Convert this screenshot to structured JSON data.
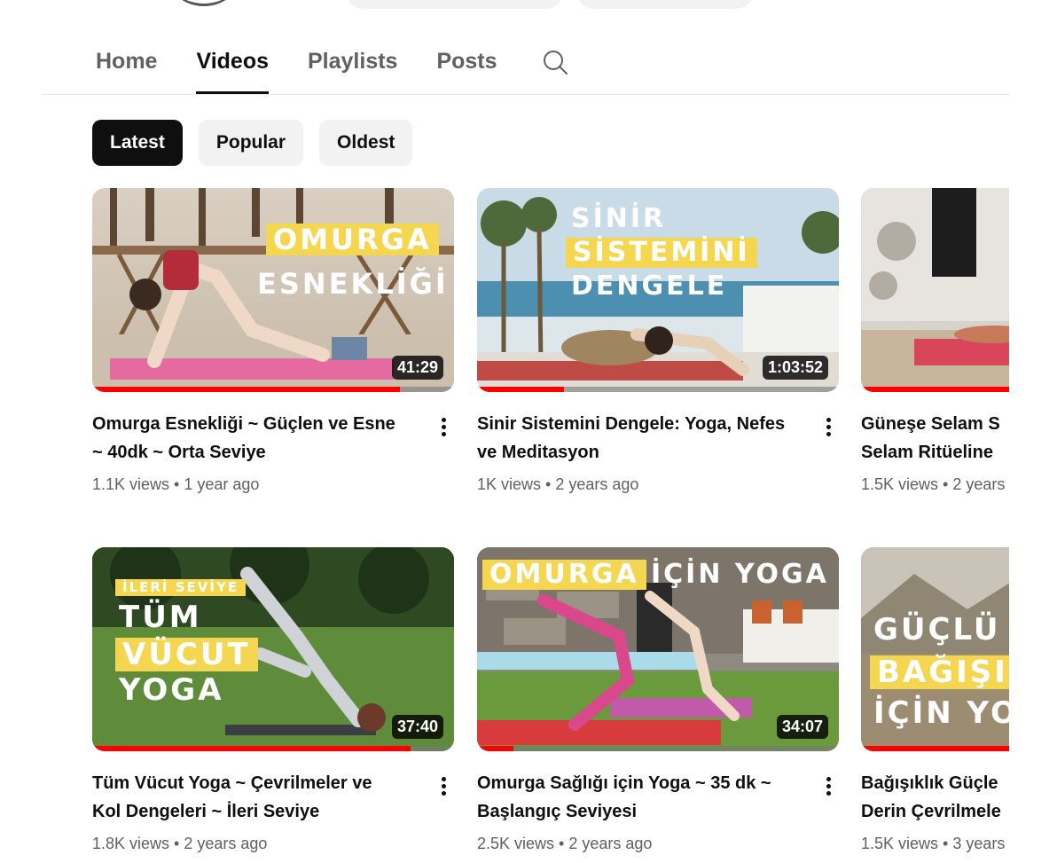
{
  "tabs": [
    {
      "label": "Home"
    },
    {
      "label": "Videos",
      "active": true
    },
    {
      "label": "Playlists"
    },
    {
      "label": "Posts"
    }
  ],
  "search_icon": "search-icon",
  "filters": [
    {
      "label": "Latest",
      "active": true
    },
    {
      "label": "Popular"
    },
    {
      "label": "Oldest"
    }
  ],
  "videos": [
    {
      "title": "Omurga Esnekliği ~ Güçlen ve Esne\n~ 40dk ~ Orta Seviye",
      "stats": "1.1K views • 1 year ago",
      "duration": "41:29",
      "overlay": [
        "OMURGA",
        "ESNEKLİĞİ"
      ],
      "watched": 0.85
    },
    {
      "title": "Sinir Sistemini Dengele: Yoga, Nefes\nve Meditasyon",
      "stats": "1K views • 2 years ago",
      "duration": "1:03:52",
      "overlay": [
        "SİNİR",
        "SİSTEMİNİ",
        "DENGELE"
      ],
      "watched": 0.24
    },
    {
      "title": "Güneşe Selam S\nSelam Ritüeline",
      "stats": "1.5K views • 2 years",
      "duration": "",
      "overlay": [],
      "watched": 0.9
    },
    {
      "title": "Tüm Vücut Yoga ~ Çevrilmeler ve\nKol Dengeleri ~ İleri Seviye",
      "stats": "1.8K views • 2 years ago",
      "duration": "37:40",
      "overlay": [
        "İLERİ SEVİYE",
        "TÜM",
        "VÜCUT",
        "YOGA"
      ],
      "watched": 0.88
    },
    {
      "title": "Omurga Sağlığı için Yoga ~ 35 dk ~\nBaşlangıç Seviyesi",
      "stats": "2.5K views • 2 years ago",
      "duration": "34:07",
      "overlay": [
        "OMURGA",
        "İÇİN YOGA"
      ],
      "watched": 0.1
    },
    {
      "title": "Bağışıklık Güçle\nDerin Çevrilmele",
      "stats": "1.5K views • 3 years",
      "duration": "",
      "overlay": [
        "GÜÇLÜ",
        "BAĞIŞIK",
        "İÇİN YO"
      ],
      "watched": 0.7
    }
  ]
}
